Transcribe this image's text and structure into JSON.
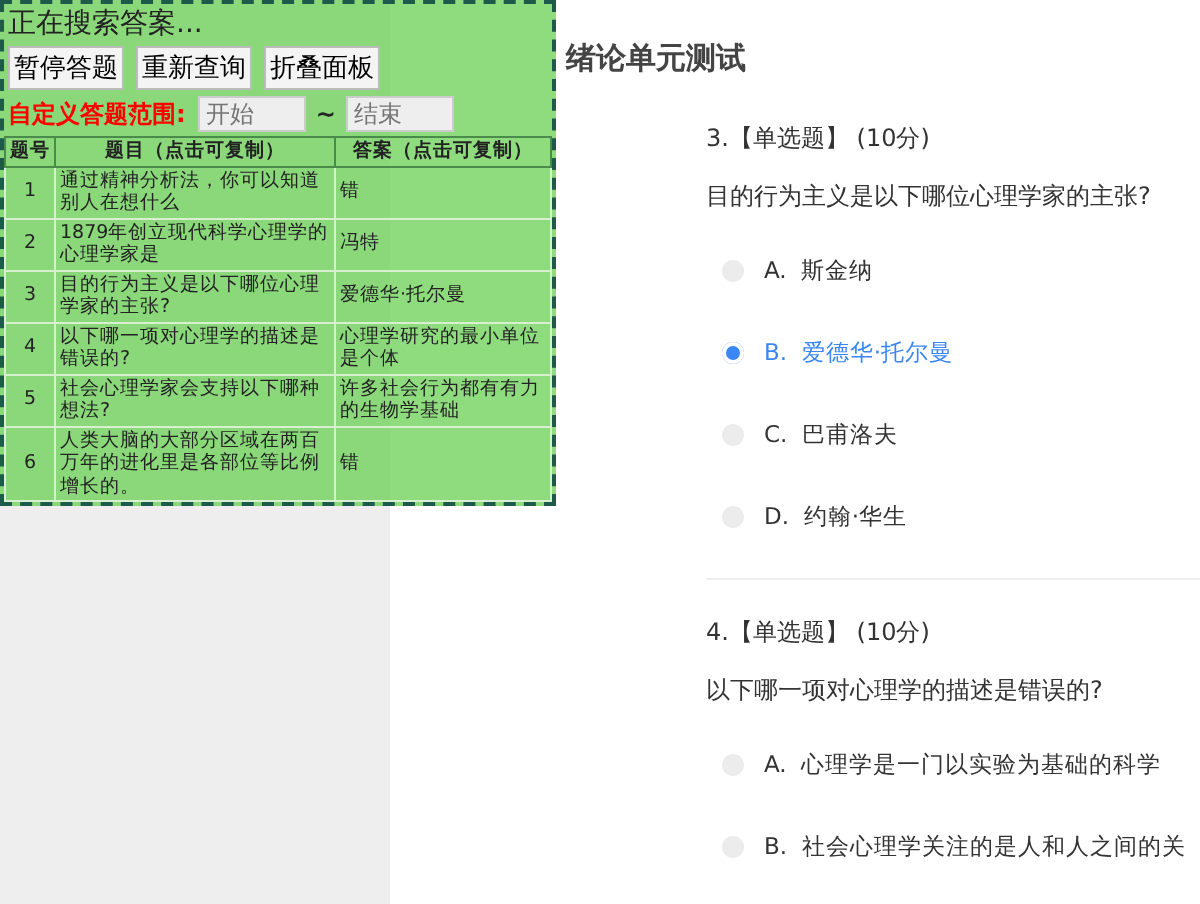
{
  "page": {
    "title": "绪论单元测试",
    "questions": [
      {
        "header": "3.【单选题】 (10分)",
        "text": "目的行为主义是以下哪位心理学家的主张?",
        "options": [
          {
            "letter": "A.",
            "text": "斯金纳",
            "selected": false
          },
          {
            "letter": "B.",
            "text": "爱德华·托尔曼",
            "selected": true
          },
          {
            "letter": "C.",
            "text": "巴甫洛夫",
            "selected": false
          },
          {
            "letter": "D.",
            "text": "约翰·华生",
            "selected": false
          }
        ]
      },
      {
        "header": "4.【单选题】 (10分)",
        "text": "以下哪一项对心理学的描述是错误的?",
        "options": [
          {
            "letter": "A.",
            "text": "心理学是一门以实验为基础的科学",
            "selected": false
          },
          {
            "letter": "B.",
            "text": "社会心理学关注的是人和人之间的关",
            "selected": false
          }
        ]
      }
    ]
  },
  "panel": {
    "status": "正在搜索答案...",
    "buttons": [
      "暂停答题",
      "重新查询",
      "折叠面板"
    ],
    "range_label": "自定义答题范围:",
    "range_start": {
      "placeholder": "开始"
    },
    "range_separator": "~",
    "range_end": {
      "placeholder": "结束"
    },
    "table": {
      "columns": [
        "题号",
        "题目（点击可复制）",
        "答案（点击可复制）"
      ],
      "rows": [
        [
          "1",
          "通过精神分析法，你可以知道别人在想什么",
          "错"
        ],
        [
          "2",
          "1879年创立现代科学心理学的心理学家是",
          "冯特"
        ],
        [
          "3",
          "目的行为主义是以下哪位心理学家的主张?",
          "爱德华·托尔曼"
        ],
        [
          "4",
          "以下哪一项对心理学的描述是错误的?",
          "心理学研究的最小单位是个体"
        ],
        [
          "5",
          "社会心理学家会支持以下哪种想法?",
          "许多社会行为都有有力的生物学基础"
        ],
        [
          "6",
          "人类大脑的大部分区域在两百万年的进化里是各部位等比例增长的。",
          "错"
        ]
      ]
    }
  }
}
